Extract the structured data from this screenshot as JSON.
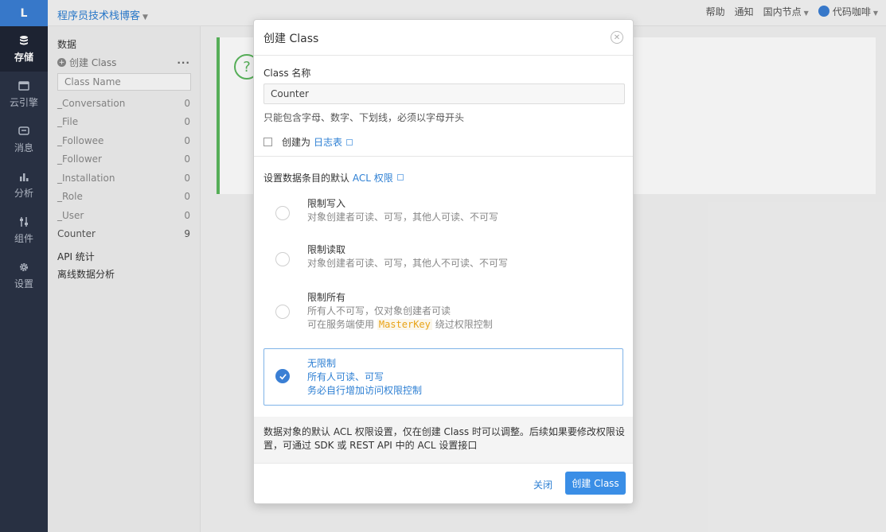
{
  "nav": {
    "logo": "L",
    "items": [
      {
        "label": "存储",
        "icon": "database-icon"
      },
      {
        "label": "云引擎",
        "icon": "cloud-engine-icon"
      },
      {
        "label": "消息",
        "icon": "message-icon"
      },
      {
        "label": "分析",
        "icon": "bar-chart-icon"
      },
      {
        "label": "组件",
        "icon": "components-icon"
      },
      {
        "label": "设置",
        "icon": "gear-icon"
      }
    ]
  },
  "topbar": {
    "app_name": "程序员技术栈博客",
    "help": "帮助",
    "notify": "通知",
    "region": "国内节点",
    "user": "代码咖啡"
  },
  "sidebar": {
    "heading": "数据",
    "create_class": "创建 Class",
    "more": "···",
    "filter_placeholder": "Class Name",
    "classes": [
      {
        "name": "_Conversation",
        "count": "0"
      },
      {
        "name": "_File",
        "count": "0"
      },
      {
        "name": "_Followee",
        "count": "0"
      },
      {
        "name": "_Follower",
        "count": "0"
      },
      {
        "name": "_Installation",
        "count": "0"
      },
      {
        "name": "_Role",
        "count": "0"
      },
      {
        "name": "_User",
        "count": "0"
      },
      {
        "name": "Counter",
        "count": "9"
      }
    ],
    "api_stats": "API 统计",
    "offline_analysis": "离线数据分析"
  },
  "modal": {
    "title": "创建 Class",
    "name_label": "Class 名称",
    "name_value": "Counter",
    "name_hint": "只能包含字母、数字、下划线，必须以字母开头",
    "log_checkbox_prefix": "创建为",
    "log_link": "日志表",
    "acl_label_prefix": "设置数据条目的默认",
    "acl_link": "ACL 权限",
    "options": [
      {
        "title": "限制写入",
        "desc": "对象创建者可读、可写，其他人可读、不可写"
      },
      {
        "title": "限制读取",
        "desc": "对象创建者可读、可写，其他人不可读、不可写"
      },
      {
        "title": "限制所有",
        "desc": "所有人不可写，仅对象创建者可读",
        "desc2_prefix": "可在服务端使用",
        "desc2_code": "MasterKey",
        "desc2_suffix": "绕过权限控制"
      },
      {
        "title": "无限制",
        "desc": "所有人可读、可写",
        "desc2": "务必自行增加访问权限控制"
      }
    ],
    "selected_option": "无限制",
    "note": "数据对象的默认 ACL 权限设置，仅在创建 Class 时可以调整。后续如果要修改权限设置，可通过 SDK 或 REST API 中的 ACL 设置接口",
    "close_button": "关闭",
    "create_button": "创建 Class"
  },
  "colors": {
    "accent": "#3a8ee6",
    "nav_bg": "#2b3346",
    "success": "#5bb85d"
  }
}
